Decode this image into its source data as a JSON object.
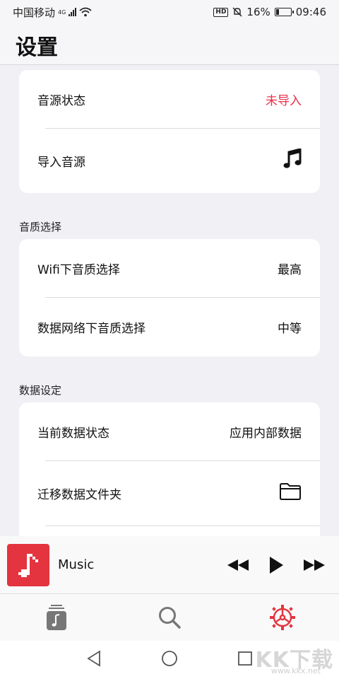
{
  "status_bar": {
    "carrier": "中国移动",
    "network": "4G",
    "hd": "HD",
    "battery": "16%",
    "time": "09:46"
  },
  "header": {
    "title": "设置"
  },
  "source_card": {
    "rows": [
      {
        "label": "音源状态",
        "value": "未导入"
      },
      {
        "label": "导入音源",
        "icon": "music-note-icon"
      }
    ]
  },
  "quality_section": {
    "title": "音质选择",
    "rows": [
      {
        "label": "Wifi下音质选择",
        "value": "最高"
      },
      {
        "label": "数据网络下音质选择",
        "value": "中等"
      }
    ]
  },
  "data_section": {
    "title": "数据设定",
    "rows": [
      {
        "label": "当前数据状态",
        "value": "应用内部数据"
      },
      {
        "label": "迁移数据文件夹",
        "icon": "folder-icon"
      }
    ]
  },
  "mini_player": {
    "title": "Music"
  },
  "tabs": [
    {
      "name": "library",
      "icon": "library-icon"
    },
    {
      "name": "search",
      "icon": "search-icon"
    },
    {
      "name": "settings",
      "icon": "settings-icon",
      "active": true
    }
  ],
  "colors": {
    "accent": "#e3343f",
    "value_red": "#e8304a",
    "background": "#f1f0f5"
  },
  "watermark": {
    "text": "KK下载",
    "url": "www.kkx.net"
  }
}
